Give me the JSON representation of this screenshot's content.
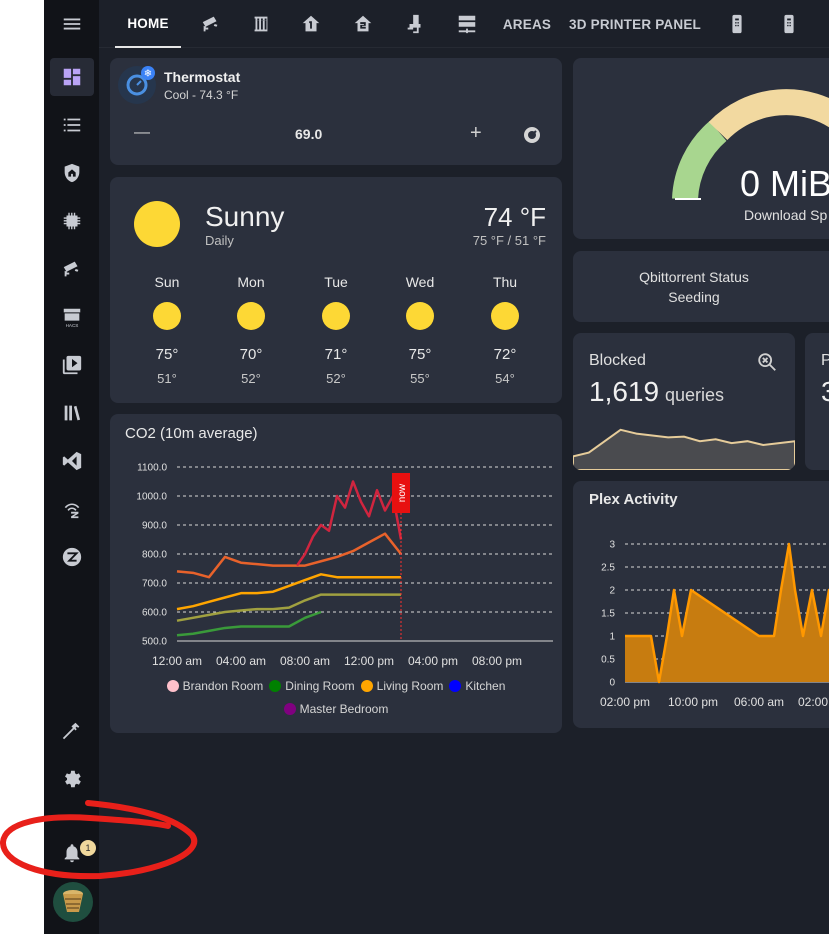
{
  "nav": {
    "tabs": [
      {
        "label": "HOME"
      },
      {
        "icon": "cctv-icon"
      },
      {
        "icon": "radiator-icon"
      },
      {
        "icon": "home-floor-1-icon"
      },
      {
        "icon": "home-floor-2-icon"
      },
      {
        "icon": "water-pump-icon"
      },
      {
        "icon": "server-icon"
      },
      {
        "label": "AREAS"
      },
      {
        "label": "3D PRINTER PANEL"
      },
      {
        "icon": "remote-icon"
      },
      {
        "icon": "remote-icon"
      }
    ]
  },
  "sidebar": {
    "notification_count": "1"
  },
  "thermostat": {
    "name": "Thermostat",
    "status": "Cool - 74.3 °F",
    "setpoint": "69.0",
    "minus": "—",
    "plus": "+"
  },
  "weather": {
    "condition": "Sunny",
    "period": "Daily",
    "temp": "74 °F",
    "high_low": "75 °F / 51 °F",
    "forecast": [
      {
        "day": "Sun",
        "high": "75°",
        "low": "51°"
      },
      {
        "day": "Mon",
        "high": "70°",
        "low": "52°"
      },
      {
        "day": "Tue",
        "high": "71°",
        "low": "52°"
      },
      {
        "day": "Wed",
        "high": "75°",
        "low": "55°"
      },
      {
        "day": "Thu",
        "high": "72°",
        "low": "54°"
      }
    ]
  },
  "co2": {
    "title": "CO2 (10m average)",
    "now_label": "now",
    "legend": [
      {
        "name": "Brandon Room",
        "color": "#ffc0cb"
      },
      {
        "name": "Dining Room",
        "color": "#008000"
      },
      {
        "name": "Living Room",
        "color": "#ffa500"
      },
      {
        "name": "Kitchen",
        "color": "#0000ff"
      },
      {
        "name": "Master Bedroom",
        "color": "#800080"
      }
    ]
  },
  "gauge": {
    "value": "0 MiB",
    "label": "Download Sp"
  },
  "qbittorrent": {
    "line1": "Qbittorrent Status",
    "line2": "Seeding"
  },
  "blocked": {
    "title": "Blocked",
    "value": "1,619",
    "unit": "queries",
    "side_title": "P",
    "side_value": "3"
  },
  "plex": {
    "title": "Plex Activity"
  },
  "chart_data": [
    {
      "type": "line",
      "title": "CO2 (10m average)",
      "x_ticks": [
        "12:00 am",
        "04:00 am",
        "08:00 am",
        "12:00 pm",
        "04:00 pm",
        "08:00 pm"
      ],
      "ylim": [
        500,
        1100
      ],
      "y_ticks": [
        "500.0",
        "600.0",
        "700.0",
        "800.0",
        "900.0",
        "1000.0",
        "1100.0"
      ],
      "series": [
        {
          "name": "Brandon Room",
          "color": "#d0253f",
          "x_hours": [
            7.5,
            8,
            8.5,
            9,
            9.5,
            10,
            10.5,
            11,
            11.5,
            12,
            12.5,
            13,
            13.5,
            14
          ],
          "values": [
            760,
            800,
            860,
            900,
            880,
            1000,
            960,
            1050,
            980,
            930,
            1020,
            950,
            1000,
            850
          ]
        },
        {
          "name": "Dining Room",
          "color": "#e8622b",
          "x_hours": [
            0,
            1,
            2,
            3,
            4,
            5,
            6,
            7,
            8,
            9,
            10,
            11,
            12,
            13,
            14
          ],
          "values": [
            740,
            735,
            720,
            790,
            770,
            765,
            760,
            760,
            760,
            775,
            790,
            810,
            840,
            870,
            800
          ]
        },
        {
          "name": "Living Room",
          "color": "#ffa500",
          "x_hours": [
            0,
            1,
            2,
            3,
            4,
            5,
            6,
            7,
            8,
            9,
            10,
            11,
            12,
            13,
            14
          ],
          "values": [
            610,
            620,
            635,
            650,
            665,
            665,
            670,
            690,
            710,
            730,
            720,
            720,
            720,
            720,
            720
          ]
        },
        {
          "name": "Kitchen",
          "color": "#a0a040",
          "x_hours": [
            0,
            1,
            2,
            3,
            4,
            5,
            6,
            7,
            8,
            9,
            10,
            11,
            12,
            13,
            14
          ],
          "values": [
            570,
            580,
            590,
            600,
            605,
            610,
            610,
            615,
            640,
            660,
            660,
            660,
            660,
            660,
            660
          ]
        },
        {
          "name": "Master Bedroom",
          "color": "#3a9a3a",
          "x_hours": [
            0,
            1,
            2,
            3,
            4,
            5,
            6,
            7,
            8,
            9
          ],
          "values": [
            520,
            525,
            535,
            545,
            550,
            550,
            550,
            550,
            580,
            600
          ]
        }
      ]
    },
    {
      "type": "area",
      "title": "Plex Activity",
      "x_ticks": [
        "02:00 pm",
        "10:00 pm",
        "06:00 am",
        "02:00"
      ],
      "ylim": [
        0,
        3
      ],
      "y_ticks": [
        "0",
        "0.5",
        "1",
        "1.5",
        "2",
        "2.5",
        "3"
      ],
      "values": [
        1,
        1,
        1,
        0,
        1,
        2,
        1,
        2,
        1,
        1,
        1,
        1,
        1,
        1,
        3,
        1,
        1,
        2,
        1,
        2,
        1
      ]
    },
    {
      "type": "area",
      "title": "Blocked",
      "values": [
        0.2,
        0.3,
        0.6,
        0.9,
        0.8,
        0.75,
        0.7,
        0.72,
        0.6,
        0.65,
        0.55,
        0.6,
        0.5,
        0.55,
        0.6
      ]
    }
  ]
}
